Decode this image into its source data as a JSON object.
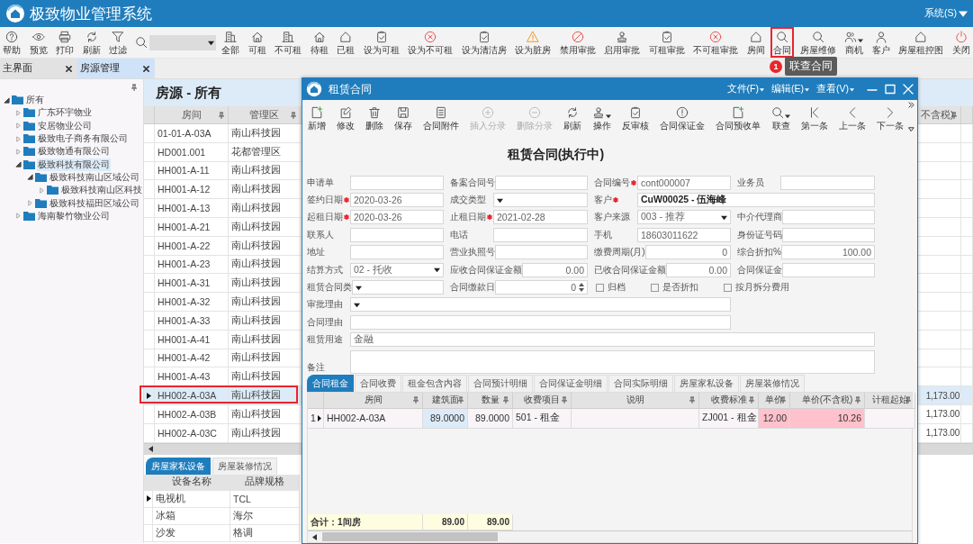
{
  "app": {
    "title": "极致物业管理系统",
    "system_menu": "系统(S)"
  },
  "toolbar": {
    "left_items": [
      {
        "label": "帮助",
        "highlighted": false,
        "dropdown": false
      },
      {
        "label": "预览",
        "highlighted": false,
        "dropdown": false
      },
      {
        "label": "打印",
        "highlighted": false,
        "dropdown": false
      },
      {
        "label": "刷新",
        "highlighted": false,
        "dropdown": false
      },
      {
        "label": "过滤",
        "highlighted": false,
        "dropdown": false
      }
    ],
    "right_items": [
      {
        "label": "全部",
        "highlighted": false,
        "dropdown": false
      },
      {
        "label": "可租",
        "highlighted": false,
        "dropdown": false
      },
      {
        "label": "不可租",
        "highlighted": false,
        "dropdown": false
      },
      {
        "label": "待租",
        "highlighted": false,
        "dropdown": false
      },
      {
        "label": "已租",
        "highlighted": false,
        "dropdown": false
      },
      {
        "label": "设为可租",
        "highlighted": false,
        "dropdown": false
      },
      {
        "label": "设为不可租",
        "highlighted": false,
        "dropdown": false
      },
      {
        "label": "设为清洁房",
        "highlighted": false,
        "dropdown": false
      },
      {
        "label": "设为脏房",
        "highlighted": false,
        "dropdown": false
      },
      {
        "label": "禁用审批",
        "highlighted": false,
        "dropdown": false
      },
      {
        "label": "启用审批",
        "highlighted": false,
        "dropdown": false
      },
      {
        "label": "可租审批",
        "highlighted": false,
        "dropdown": false
      },
      {
        "label": "不可租审批",
        "highlighted": false,
        "dropdown": false
      },
      {
        "label": "房间",
        "highlighted": false,
        "dropdown": false
      },
      {
        "label": "合同",
        "highlighted": true,
        "dropdown": false
      },
      {
        "label": "房屋维修",
        "highlighted": false,
        "dropdown": false
      },
      {
        "label": "商机",
        "highlighted": false,
        "dropdown": true
      },
      {
        "label": "客户",
        "highlighted": false,
        "dropdown": false
      },
      {
        "label": "房屋租控图",
        "highlighted": false,
        "dropdown": false
      },
      {
        "label": "关闭",
        "highlighted": false,
        "dropdown": false
      }
    ]
  },
  "tooltip": {
    "badge": "1",
    "text": "联查合同"
  },
  "tabs": [
    {
      "label": "主界面",
      "selected": false
    },
    {
      "label": "房源管理",
      "selected": true
    }
  ],
  "tree": {
    "items": [
      {
        "label": "所有",
        "expanded": true,
        "selected": false,
        "children": [
          {
            "label": "广东环宇物业",
            "expanded": false,
            "selected": false
          },
          {
            "label": "安居物业公司",
            "expanded": false,
            "selected": false
          },
          {
            "label": "极致电子商务有限公司",
            "expanded": false,
            "selected": false
          },
          {
            "label": "极致物通有限公司",
            "expanded": false,
            "selected": false
          },
          {
            "label": "极致科技有限公司",
            "expanded": true,
            "selected": true,
            "children": [
              {
                "label": "极致科技南山区域公司",
                "expanded": true,
                "selected": false,
                "children": [
                  {
                    "label": "极致科技南山区科技",
                    "expanded": false,
                    "selected": false
                  }
                ]
              },
              {
                "label": "极致科技福田区域公司",
                "expanded": false,
                "selected": false
              }
            ]
          },
          {
            "label": "海南黎竹物业公司",
            "expanded": false,
            "selected": false
          }
        ]
      }
    ]
  },
  "rooms": {
    "title": "房源 - 所有",
    "columns": [
      "房间",
      "管理区"
    ],
    "column_3": "不含税)",
    "rows": [
      {
        "cells": [
          "01-01-A-03A",
          "南山科技园"
        ],
        "selected": false,
        "highlighted": false
      },
      {
        "cells": [
          "HD001.001",
          "花都管理区"
        ],
        "selected": false,
        "highlighted": false
      },
      {
        "cells": [
          "HH001-A-11",
          "南山科技园"
        ],
        "selected": false,
        "highlighted": false
      },
      {
        "cells": [
          "HH001-A-12",
          "南山科技园"
        ],
        "selected": false,
        "highlighted": false
      },
      {
        "cells": [
          "HH001-A-13",
          "南山科技园"
        ],
        "selected": false,
        "highlighted": false
      },
      {
        "cells": [
          "HH001-A-21",
          "南山科技园"
        ],
        "selected": false,
        "highlighted": false
      },
      {
        "cells": [
          "HH001-A-22",
          "南山科技园"
        ],
        "selected": false,
        "highlighted": false
      },
      {
        "cells": [
          "HH001-A-23",
          "南山科技园"
        ],
        "selected": false,
        "highlighted": false
      },
      {
        "cells": [
          "HH001-A-31",
          "南山科技园"
        ],
        "selected": false,
        "highlighted": false
      },
      {
        "cells": [
          "HH001-A-32",
          "南山科技园"
        ],
        "selected": false,
        "highlighted": false
      },
      {
        "cells": [
          "HH001-A-33",
          "南山科技园"
        ],
        "selected": false,
        "highlighted": false
      },
      {
        "cells": [
          "HH001-A-41",
          "南山科技园"
        ],
        "selected": false,
        "highlighted": false
      },
      {
        "cells": [
          "HH001-A-42",
          "南山科技园"
        ],
        "selected": false,
        "highlighted": false
      },
      {
        "cells": [
          "HH001-A-43",
          "南山科技园"
        ],
        "selected": false,
        "highlighted": false
      },
      {
        "cells": [
          "HH002-A-03A",
          "南山科技园"
        ],
        "column_3": "1,173.00",
        "selected": true,
        "highlighted": true
      },
      {
        "cells": [
          "HH002-A-03B",
          "南山科技园"
        ],
        "column_3": "1,173.00",
        "selected": false,
        "highlighted": false
      },
      {
        "cells": [
          "HH002-A-03C",
          "南山科技园"
        ],
        "column_3": "1,173.00",
        "selected": false,
        "highlighted": false
      }
    ],
    "sub_tabs": [
      {
        "label": "房屋家私设备",
        "selected": true
      },
      {
        "label": "房屋装修情况",
        "selected": false
      }
    ],
    "equipment": {
      "columns": [
        "设备名称",
        "品牌规格"
      ],
      "rows": [
        {
          "cells": [
            "电视机",
            "TCL"
          ],
          "current": true
        },
        {
          "cells": [
            "冰箱",
            "海尔"
          ],
          "current": false
        },
        {
          "cells": [
            "沙发",
            "格调"
          ],
          "current": false
        }
      ]
    }
  },
  "dialog": {
    "title": "租赁合同",
    "menus": [
      "文件(F)",
      "编辑(E)",
      "查看(V)"
    ],
    "toolbar": [
      {
        "label": "新增",
        "disabled": false,
        "dropdown": false
      },
      {
        "label": "修改",
        "disabled": false,
        "dropdown": false
      },
      {
        "label": "删除",
        "disabled": false,
        "dropdown": false
      },
      {
        "label": "保存",
        "disabled": false,
        "dropdown": false
      },
      {
        "label": "合同附件",
        "disabled": false,
        "dropdown": false
      },
      {
        "label": "插入分录",
        "disabled": true,
        "dropdown": false
      },
      {
        "label": "删除分录",
        "disabled": true,
        "dropdown": false
      },
      {
        "label": "刷新",
        "disabled": false,
        "dropdown": false
      },
      {
        "label": "操作",
        "disabled": false,
        "dropdown": true
      },
      {
        "label": "反审核",
        "disabled": false,
        "dropdown": false
      },
      {
        "label": "合同保证金",
        "disabled": false,
        "dropdown": false
      },
      {
        "label": "合同预收单",
        "disabled": false,
        "dropdown": false
      },
      {
        "label": "联查",
        "disabled": false,
        "dropdown": true
      },
      {
        "label": "第一条",
        "disabled": false,
        "dropdown": false
      },
      {
        "label": "上一条",
        "disabled": false,
        "dropdown": false
      },
      {
        "label": "下一条",
        "disabled": false,
        "dropdown": false
      }
    ],
    "form_title": "租赁合同(执行中)",
    "form": {
      "rows": [
        {
          "fields": [
            {
              "label": "申请单",
              "kind": "text",
              "required": false
            },
            {
              "label": "备案合同号",
              "kind": "text",
              "required": false
            },
            {
              "label": "合同编号",
              "kind": "text",
              "required": true,
              "value": "cont000007"
            },
            {
              "label": "业务员",
              "kind": "text",
              "required": false
            }
          ]
        },
        {
          "fields": [
            {
              "label": "签约日期",
              "kind": "text",
              "required": true,
              "value": "2020-03-26"
            },
            {
              "label": "成交类型",
              "kind": "select",
              "required": false
            },
            {
              "label": "客户",
              "kind": "wide-text",
              "required": true,
              "value": "CuW00025 - 伍海峰"
            }
          ]
        },
        {
          "fields": [
            {
              "label": "起租日期",
              "kind": "text",
              "required": true,
              "value": "2020-03-26"
            },
            {
              "label": "止租日期",
              "kind": "text",
              "required": true,
              "value": "2021-02-28"
            },
            {
              "label": "客户来源",
              "kind": "select",
              "required": false,
              "value": "003 - 推荐"
            },
            {
              "label": "中介代理商",
              "kind": "text",
              "required": false
            }
          ]
        },
        {
          "fields": [
            {
              "label": "联系人",
              "kind": "text",
              "required": false
            },
            {
              "label": "电话",
              "kind": "text",
              "required": false
            },
            {
              "label": "手机",
              "kind": "text",
              "required": false,
              "value": "18603011622"
            },
            {
              "label": "身份证号码",
              "kind": "text",
              "required": false
            }
          ]
        },
        {
          "fields": [
            {
              "label": "地址",
              "kind": "text",
              "required": false
            },
            {
              "label": "营业执照号",
              "kind": "text",
              "required": false
            },
            {
              "label": "缴费周期(月)",
              "kind": "number",
              "required": false,
              "value": "0"
            },
            {
              "label": "综合折扣%",
              "kind": "number",
              "required": false,
              "value": "100.00"
            }
          ]
        },
        {
          "fields": [
            {
              "label": "结算方式",
              "kind": "select",
              "required": false,
              "value": "02 - 托收"
            },
            {
              "label": "应收合同保证金额",
              "kind": "number",
              "required": false,
              "value": "0.00"
            },
            {
              "label": "已收合同保证金额",
              "kind": "number",
              "required": false,
              "value": "0.00"
            },
            {
              "label": "合同保证金",
              "kind": "text",
              "required": false
            }
          ]
        },
        {
          "fields": [
            {
              "label": "租赁合同类",
              "kind": "select",
              "required": false
            },
            {
              "label": "合同缴款日",
              "kind": "spinner",
              "required": false,
              "value": "0"
            },
            {
              "label": "归档",
              "kind": "checkbox",
              "checked": false
            },
            {
              "label": "是否折扣",
              "kind": "checkbox",
              "checked": false
            },
            {
              "label": "按月拆分费用",
              "kind": "checkbox",
              "checked": false
            }
          ]
        },
        {
          "fields": [
            {
              "label": "审批理由",
              "kind": "long-select",
              "required": false
            }
          ]
        },
        {
          "fields": [
            {
              "label": "合同理由",
              "kind": "long-text",
              "required": false
            }
          ]
        },
        {
          "fields": [
            {
              "label": "租赁用途",
              "kind": "full-text",
              "required": false,
              "value": "金融"
            }
          ]
        },
        {
          "fields": [
            {
              "label": "备注",
              "kind": "memo",
              "required": false
            }
          ]
        }
      ]
    },
    "tabs": [
      {
        "label": "合同租金",
        "selected": true
      },
      {
        "label": "合同收费",
        "selected": false
      },
      {
        "label": "租金包含内容",
        "selected": false
      },
      {
        "label": "合同预计明细",
        "selected": false
      },
      {
        "label": "合同保证金明细",
        "selected": false
      },
      {
        "label": "合同实际明细",
        "selected": false
      },
      {
        "label": "房屋家私设备",
        "selected": false
      },
      {
        "label": "房屋装修情况",
        "selected": false
      }
    ],
    "grid": {
      "columns": [
        "房间",
        "建筑面",
        "数量",
        "收费项目",
        "说明",
        "收费标准",
        "单价",
        "单价(不含税)",
        "计租起始"
      ],
      "rows": [
        {
          "number": "1",
          "current": true,
          "cells": [
            {
              "text": "HH002-A-03A",
              "color": "#f8f4f8"
            },
            {
              "text": "89.0000",
              "color": "#dcebf7"
            },
            {
              "text": "89.0000",
              "color": "#f8f4f8"
            },
            {
              "text": "501 - 租金",
              "color": "#f8f4f8"
            },
            {
              "color": "#f8f4f8"
            },
            {
              "text": "ZJ001 - 租金",
              "color": "#f8f4f8"
            },
            {
              "text": "12.00",
              "color": "#ffc1cc"
            },
            {
              "text": "10.26",
              "color": "#ffc1cc"
            },
            {
              "color": "#f8f4f8"
            }
          ]
        }
      ],
      "footer": [
        "合计：1间房",
        "89.00",
        "89.00"
      ]
    }
  }
}
